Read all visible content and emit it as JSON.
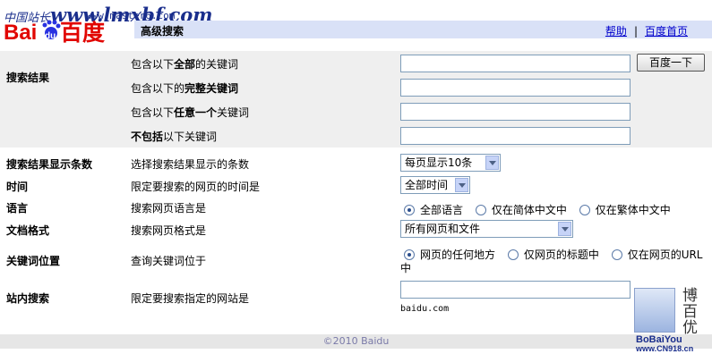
{
  "watermark": {
    "prefix": "中国站长",
    "big": "www.lmxbf.com",
    "site": "www.master6.com"
  },
  "logo": {
    "text_bai": "Bai",
    "text_du": "du",
    "text_cn": "百度"
  },
  "header": {
    "title": "高级搜索",
    "help": "帮助",
    "separator": "|",
    "home": "百度首页"
  },
  "search_results": {
    "label": "搜索结果",
    "row1": {
      "pre": "包含以下",
      "bold": "全部",
      "post": "的关键词"
    },
    "row2": {
      "pre": "包含以下的",
      "bold": "完整关键词",
      "post": ""
    },
    "row3": {
      "pre": "包含以下",
      "bold": "任意一个",
      "post": "关键词"
    },
    "row4": {
      "pre": "",
      "bold": "不包括",
      "post": "以下关键词"
    },
    "button": "百度一下"
  },
  "count": {
    "label": "搜索结果显示条数",
    "desc": "选择搜索结果显示的条数",
    "value": "每页显示10条"
  },
  "time": {
    "label": "时间",
    "desc": "限定要搜索的网页的时间是",
    "value": "全部时间"
  },
  "language": {
    "label": "语言",
    "desc": "搜索网页语言是",
    "opt1": "全部语言",
    "opt2": "仅在简体中文中",
    "opt3": "仅在繁体中文中"
  },
  "format": {
    "label": "文档格式",
    "desc": "搜索网页格式是",
    "value": "所有网页和文件"
  },
  "position": {
    "label": "关键词位置",
    "desc": "查询关键词位于",
    "opt1": "网页的任何地方",
    "opt2": "仅网页的标题中",
    "opt3": "仅在网页的URL",
    "opt3_wrap": "中"
  },
  "site": {
    "label": "站内搜索",
    "desc": "限定要搜索指定的网站是",
    "hint": "baidu.com"
  },
  "footer": "©2010 Baidu",
  "corner": {
    "chars": [
      "博",
      "百",
      "优"
    ],
    "brand": "BoBaiYou",
    "url": "www.CN918.cn"
  },
  "colors": {
    "accent_bar": "#d9e1f7",
    "band": "#efefef",
    "link": "#0000cc",
    "logo_red": "#e10602",
    "logo_blue": "#2932e1"
  }
}
